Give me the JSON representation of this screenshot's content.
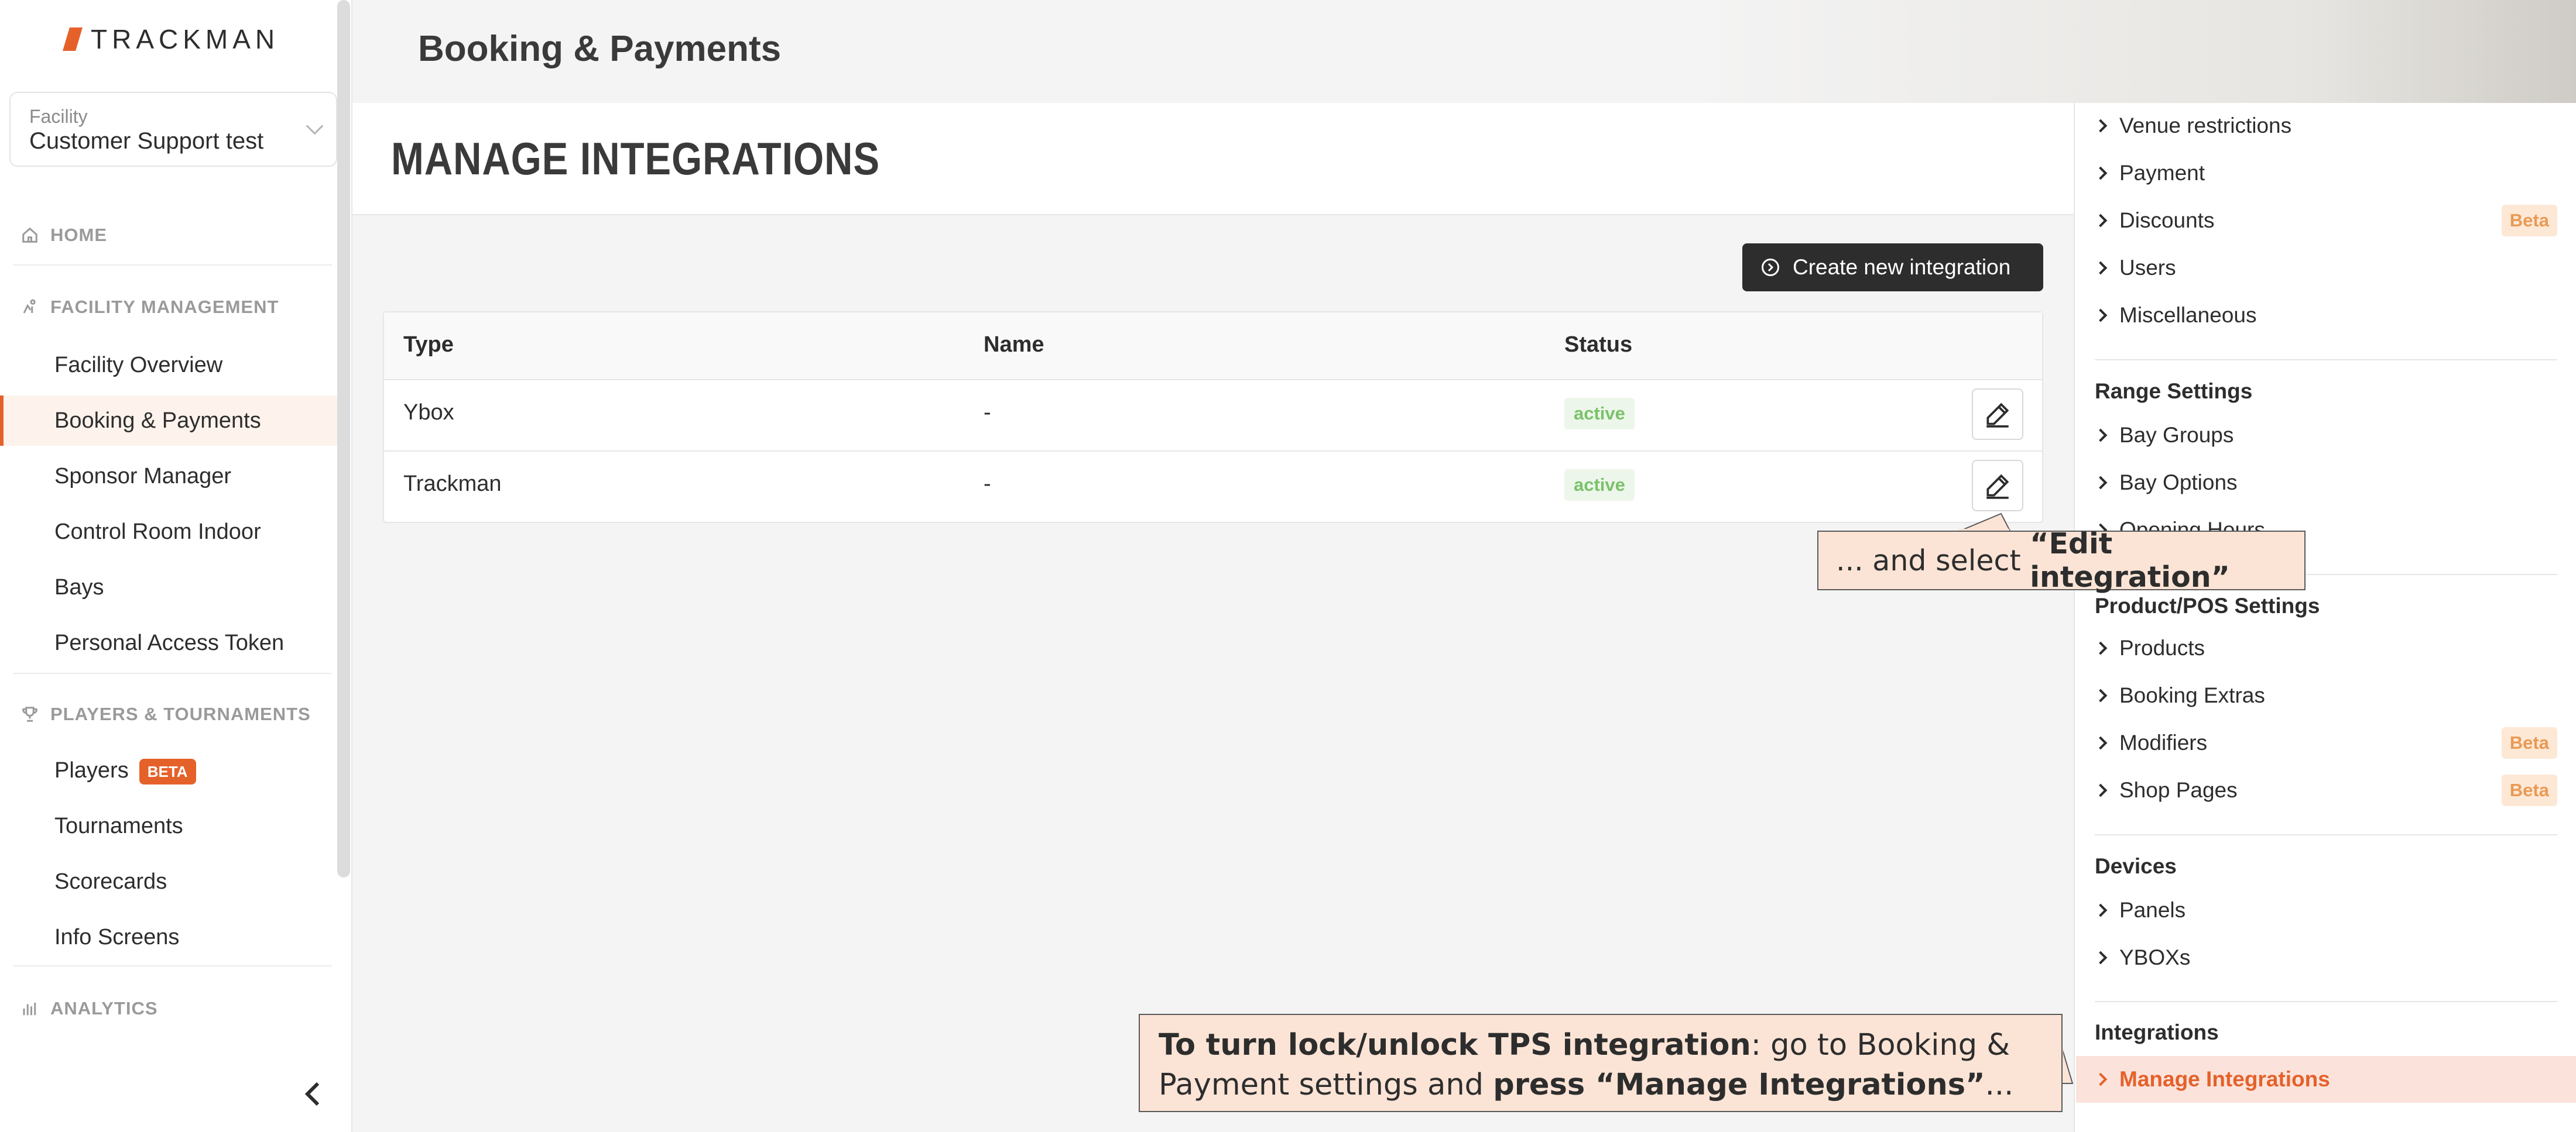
{
  "brand": {
    "name": "TRACKMAN",
    "accent": "#e5612a"
  },
  "facility": {
    "label": "Facility",
    "value": "Customer Support test"
  },
  "nav": {
    "home": "HOME",
    "facility_management": "FACILITY MANAGEMENT",
    "fm_items": [
      "Facility Overview",
      "Booking & Payments",
      "Sponsor Manager",
      "Control Room Indoor",
      "Bays",
      "Personal Access Token"
    ],
    "players_tournaments": "PLAYERS & TOURNAMENTS",
    "pt_items": [
      "Players",
      "Tournaments",
      "Scorecards",
      "Info Screens"
    ],
    "players_badge": "BETA",
    "analytics": "ANALYTICS"
  },
  "header": {
    "title": "Booking & Payments"
  },
  "main": {
    "heading": "MANAGE INTEGRATIONS",
    "create_button": "Create new integration",
    "table": {
      "columns": [
        "Type",
        "Name",
        "Status"
      ],
      "rows": [
        {
          "type": "Ybox",
          "name": "-",
          "status": "active"
        },
        {
          "type": "Trackman",
          "name": "-",
          "status": "active"
        }
      ]
    }
  },
  "settings": {
    "top_items": [
      "Venue restrictions",
      "Payment",
      "Discounts",
      "Users",
      "Miscellaneous"
    ],
    "beta": "Beta",
    "range_settings": "Range Settings",
    "range_items": [
      "Bay Groups",
      "Bay Options",
      "Opening Hours"
    ],
    "product_pos": "Product/POS Settings",
    "product_items": [
      "Products",
      "Booking Extras",
      "Modifiers",
      "Shop Pages"
    ],
    "devices": "Devices",
    "device_items": [
      "Panels",
      "YBOXs"
    ],
    "integrations": "Integrations",
    "integration_items": [
      "Manage Integrations"
    ]
  },
  "callouts": {
    "edit": {
      "prefix": "... and select ",
      "bold": "“Edit integration”"
    },
    "lock": {
      "bold1": "To turn lock/unlock TPS integration",
      "text1": ": go to Booking &",
      "text2": "Payment settings and ",
      "bold2": "press “Manage Integrations”",
      "text3": "..."
    }
  }
}
